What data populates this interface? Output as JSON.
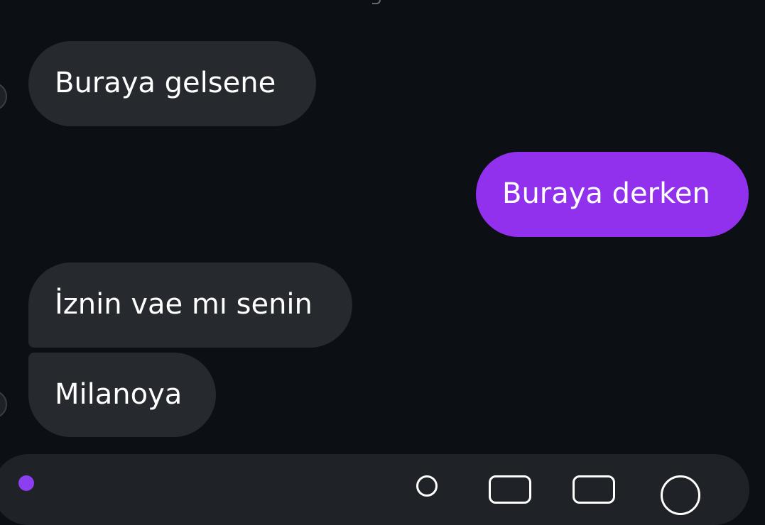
{
  "messages": [
    {
      "text": "Buraya gelsene",
      "direction": "incoming"
    },
    {
      "text": "Buraya derken",
      "direction": "outgoing"
    },
    {
      "text": "İznin vae mı senin",
      "direction": "incoming"
    },
    {
      "text": "Milanoya",
      "direction": "incoming"
    }
  ],
  "colors": {
    "background": "#0c1014",
    "incoming_bubble": "#262a2f",
    "outgoing_bubble": "#9131ee",
    "text": "#ffffff",
    "composer": "#1f2226"
  },
  "composer": {
    "icons": [
      "camera-icon",
      "microphone-icon",
      "gallery-icon",
      "sticker-icon",
      "plus-icon"
    ]
  }
}
